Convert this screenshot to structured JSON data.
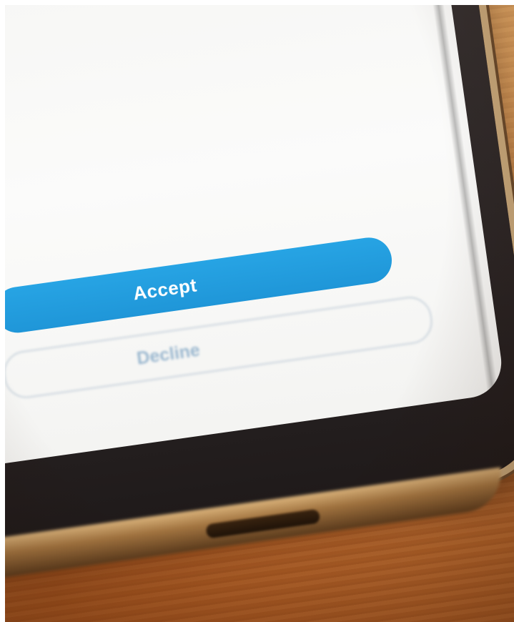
{
  "photo": {
    "description_colors": {
      "table": "#c47436",
      "screen": "#f6f6f4",
      "accent": "#1f96d8",
      "decline_text": "#9ab7cf",
      "phone_frame": "#2c2626"
    }
  },
  "dialog": {
    "body_lines": [
      "",
      "",
      "",
      "",
      ""
    ],
    "accept_label": "Accept",
    "decline_label": "Decline"
  }
}
